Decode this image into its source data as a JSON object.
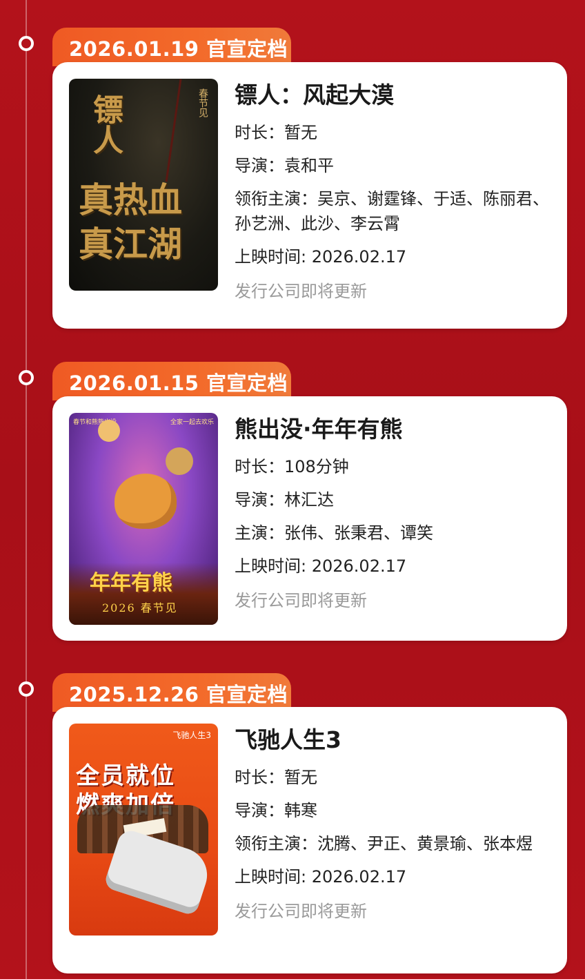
{
  "entries": [
    {
      "tab_label": "2026.01.19 官宣定档",
      "title": "镖人：风起大漠",
      "duration": "时长：暂无",
      "director": "导演：袁和平",
      "cast": "领衔主演：吴京、谢霆锋、于适、陈丽君、孙艺洲、此沙、李云霄",
      "release": "上映时间: 2026.02.17",
      "distributor": "发行公司即将更新",
      "poster": {
        "text_line1": "镖人",
        "text_line2": "真热血",
        "text_line3": "真江湖",
        "corner": "春节见"
      }
    },
    {
      "tab_label": "2026.01.15 官宣定档",
      "title": "熊出没·年年有熊",
      "duration": "时长：108分钟",
      "director": "导演：林汇达",
      "cast": "主演：张伟、张秉君、谭笑",
      "release": "上映时间: 2026.02.17",
      "distributor": "发行公司即将更新",
      "poster": {
        "logo": "年年有熊",
        "year": "2026 春节见",
        "tag_left": "春节和熊熊出没",
        "tag_right": "全家一起去欢乐"
      }
    },
    {
      "tab_label": "2025.12.26 官宣定档",
      "title": "飞驰人生3",
      "duration": "时长：暂无",
      "director": "导演：韩寒",
      "cast": "领衔主演：沈腾、尹正、黄景瑜、张本煜",
      "release": "上映时间: 2026.02.17",
      "distributor": "发行公司即将更新",
      "poster": {
        "line1": "全员就位",
        "line2": "燃爽加倍",
        "corner": "飞驰人生3"
      }
    }
  ],
  "colors": {
    "background": "#b3121b",
    "tab": "#ef5a24",
    "muted_text": "#9a9a9a"
  }
}
